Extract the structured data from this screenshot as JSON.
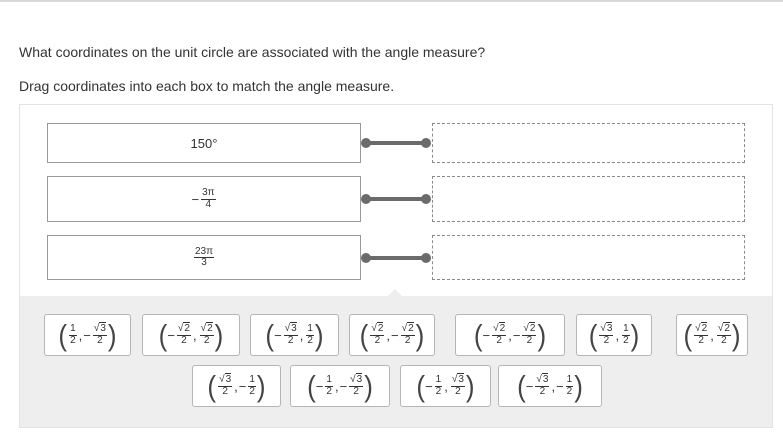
{
  "question": "What coordinates on the unit circle are associated with the angle measure?",
  "instruction": "Drag coordinates into each box to match the angle measure.",
  "prompts": [
    {
      "type": "text",
      "text": "150°"
    },
    {
      "type": "frac",
      "sign": "−",
      "num": "3π",
      "den": "4"
    },
    {
      "type": "frac",
      "sign": "",
      "num": "23π",
      "den": "3"
    }
  ],
  "tiles": [
    {
      "x": {
        "sign": "",
        "num": "1",
        "den": "2",
        "root": false
      },
      "y": {
        "sign": "−",
        "num": "3",
        "den": "2",
        "root": true
      }
    },
    {
      "x": {
        "sign": "−",
        "num": "2",
        "den": "2",
        "root": true
      },
      "y": {
        "sign": "",
        "num": "2",
        "den": "2",
        "root": true
      }
    },
    {
      "x": {
        "sign": "−",
        "num": "3",
        "den": "2",
        "root": true
      },
      "y": {
        "sign": "",
        "num": "1",
        "den": "2",
        "root": false
      }
    },
    {
      "x": {
        "sign": "",
        "num": "2",
        "den": "2",
        "root": true
      },
      "y": {
        "sign": "−",
        "num": "2",
        "den": "2",
        "root": true
      }
    },
    {
      "x": {
        "sign": "−",
        "num": "2",
        "den": "2",
        "root": true
      },
      "y": {
        "sign": "−",
        "num": "2",
        "den": "2",
        "root": true
      }
    },
    {
      "x": {
        "sign": "",
        "num": "3",
        "den": "2",
        "root": true
      },
      "y": {
        "sign": "",
        "num": "1",
        "den": "2",
        "root": false
      }
    },
    {
      "x": {
        "sign": "",
        "num": "2",
        "den": "2",
        "root": true
      },
      "y": {
        "sign": "",
        "num": "2",
        "den": "2",
        "root": true
      }
    },
    {
      "x": {
        "sign": "",
        "num": "3",
        "den": "2",
        "root": true
      },
      "y": {
        "sign": "−",
        "num": "1",
        "den": "2",
        "root": false
      }
    },
    {
      "x": {
        "sign": "−",
        "num": "1",
        "den": "2",
        "root": false
      },
      "y": {
        "sign": "−",
        "num": "3",
        "den": "2",
        "root": true
      }
    },
    {
      "x": {
        "sign": "−",
        "num": "1",
        "den": "2",
        "root": false
      },
      "y": {
        "sign": "",
        "num": "3",
        "den": "2",
        "root": true
      }
    },
    {
      "x": {
        "sign": "−",
        "num": "3",
        "den": "2",
        "root": true
      },
      "y": {
        "sign": "−",
        "num": "1",
        "den": "2",
        "root": false
      }
    }
  ],
  "drop_targets": [
    "",
    "",
    ""
  ]
}
